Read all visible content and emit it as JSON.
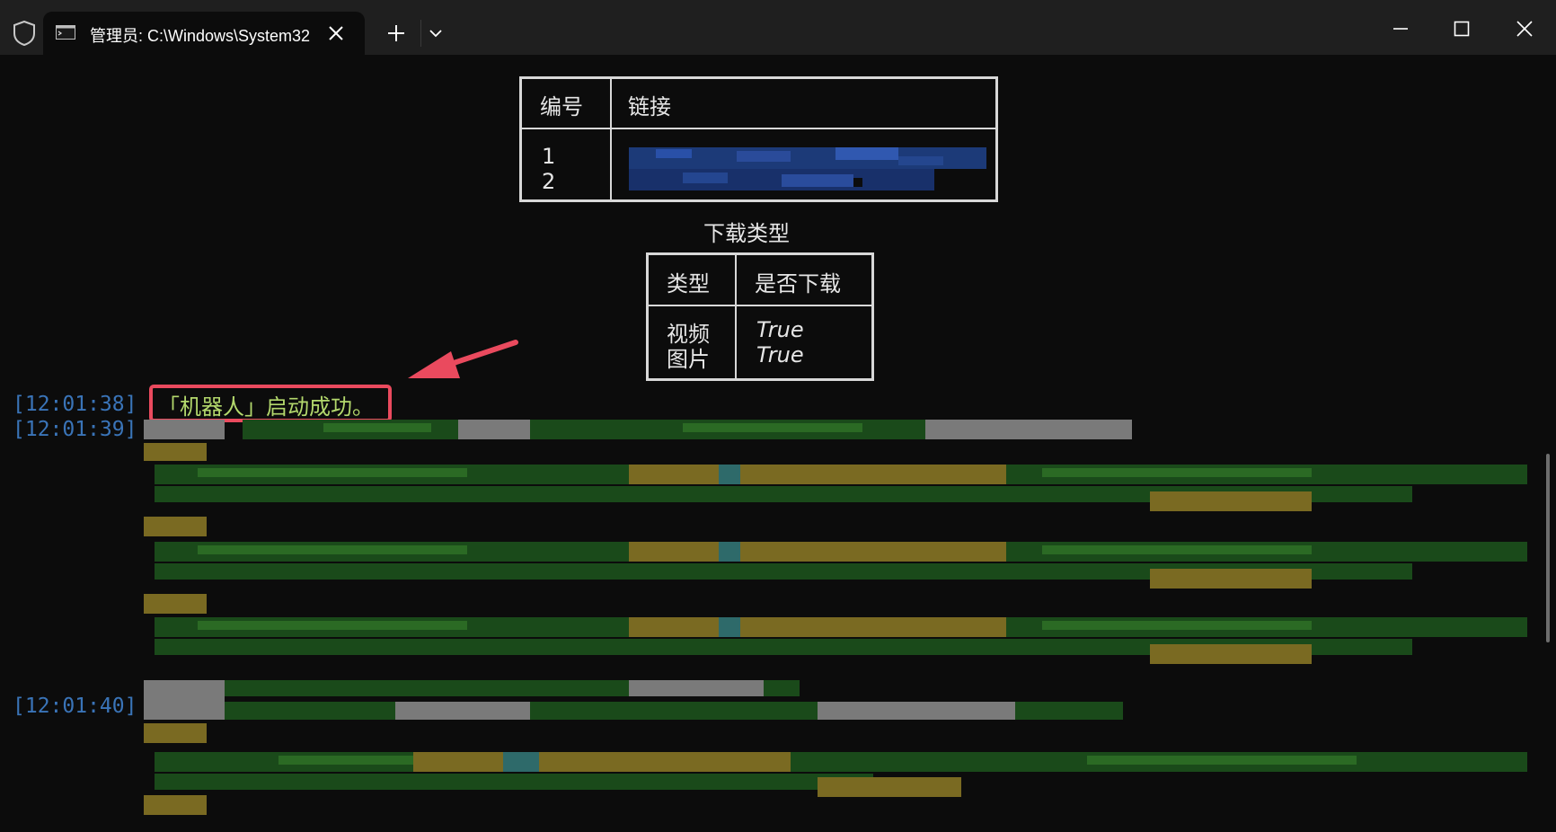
{
  "window": {
    "tab_title": "管理员: C:\\Windows\\System32",
    "icons": [
      "shield-icon",
      "terminal-icon",
      "close-icon",
      "plus-icon",
      "chevron-down-icon",
      "minimize-icon",
      "maximize-icon",
      "close-window-icon"
    ]
  },
  "links_table": {
    "headers": [
      "编号",
      "链接"
    ],
    "numbers": [
      "1",
      "2"
    ]
  },
  "download_caption": "下载类型",
  "download_table": {
    "headers": [
      "类型",
      "是否下载"
    ],
    "rows": [
      {
        "type": "视频",
        "value": "True"
      },
      {
        "type": "图片",
        "value": "True"
      }
    ]
  },
  "log": {
    "lines": [
      {
        "time": "[12:01:38]",
        "text": "「机器人」启动成功。"
      },
      {
        "time": "[12:01:39]",
        "text": ""
      },
      {
        "time": "[12:01:40]",
        "text": ""
      }
    ]
  },
  "colors": {
    "background": "#0c0c0c",
    "timestamp": "#3a74b8",
    "success_text": "#b3d86c",
    "true_value": "#22c02a",
    "annotation": "#ea4a5e"
  }
}
